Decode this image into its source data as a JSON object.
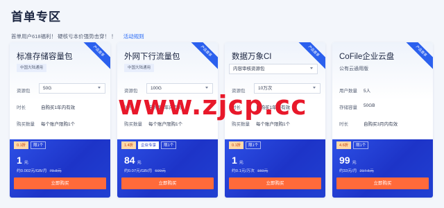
{
  "page": {
    "title": "首单专区",
    "subtitle": "首单用户618福利！ 硬核亏本价强势击穿！ ！",
    "rules_link": "活动规则"
  },
  "watermark": "www.zjcp.cc",
  "cards": [
    {
      "name": "标准存储容量包",
      "ribbon": "产品首享",
      "tag": "中国大陆通用",
      "rows": [
        {
          "label": "资源包",
          "value": "50G",
          "kind": "select"
        },
        {
          "label": "时长",
          "value": "自购买1年内有效"
        },
        {
          "label": "购买数量",
          "value": "每个账户限购1个"
        }
      ],
      "badges": [
        "0.1折",
        "限1个"
      ],
      "price": "1",
      "price_unit": "元",
      "unit_price": "约0.002元/GB/月",
      "original_price": "79.8元",
      "buy": "立即购买"
    },
    {
      "name": "外网下行流量包",
      "ribbon": "产品首享",
      "tag": "中国大陆通用",
      "rows": [
        {
          "label": "资源包",
          "value": "100G",
          "kind": "select"
        },
        {
          "label": "时长",
          "value": "自购买1年内有效"
        },
        {
          "label": "购买数量",
          "value": "每个账户限购1个"
        }
      ],
      "badges": [
        "1.4折",
        "企业专享",
        "限1个"
      ],
      "price": "84",
      "price_unit": "元",
      "unit_price": "约0.07元/GB/月",
      "original_price": "600元",
      "buy": "立即购买"
    },
    {
      "name": "数据万象CI",
      "ribbon": "产品首享",
      "select": "内容审核资源包",
      "rows": [
        {
          "label": "资源包",
          "value": "10万次",
          "kind": "select"
        },
        {
          "label": "时长",
          "value": "自购买1年内有效"
        },
        {
          "label": "购买数量",
          "value": "每个账户限购1个"
        }
      ],
      "badges": [
        "0.1折",
        "限1个"
      ],
      "price": "1",
      "price_unit": "元",
      "unit_price": "约0.1元/万次",
      "original_price": "150元",
      "buy": "立即购买"
    },
    {
      "name": "CoFile企业云盘",
      "ribbon": "产品首享",
      "desc": "公有云通用版",
      "rows": [
        {
          "label": "用户数量",
          "value": "5人"
        },
        {
          "label": "存储容量",
          "value": "50GB"
        },
        {
          "label": "时长",
          "value": "自购买3月内有效"
        }
      ],
      "badges": [
        "4.6折",
        "限1个"
      ],
      "price": "99",
      "price_unit": "元",
      "unit_price": "约33元/月",
      "original_price": "217.5元",
      "buy": "立即购买"
    }
  ]
}
